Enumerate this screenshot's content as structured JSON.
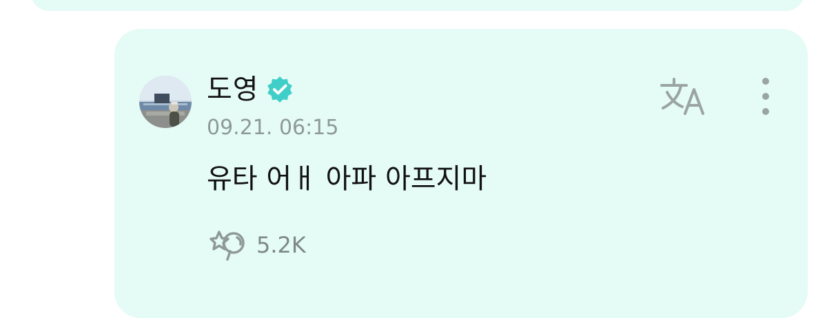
{
  "post": {
    "author": "도영",
    "timestamp": "09.21. 06:15",
    "message": "유타 어ㅐ 아파 아프지마",
    "likes": "5.2K"
  },
  "icons": {
    "verified": "verified-badge-icon",
    "translate": "translate-icon",
    "more": "more-vertical-icon",
    "like": "reaction-icon"
  },
  "colors": {
    "card_background": "#e5fbf5",
    "verified": "#40cfc8",
    "muted_text": "#8f9a98",
    "icon": "#9aa5a3"
  }
}
